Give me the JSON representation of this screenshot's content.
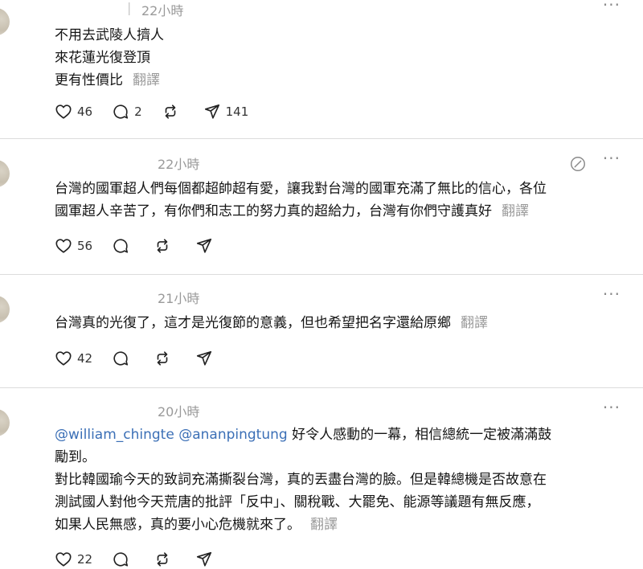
{
  "posts": [
    {
      "time": "22小時",
      "lines": [
        "不用去武陵人擠人",
        "來花蓮光復登頂",
        "更有性價比"
      ],
      "translate": "翻譯",
      "likes": "46",
      "comments": "2",
      "reposts": "",
      "shares": "141"
    },
    {
      "time": "22小時",
      "lines": [
        "台灣的國軍超人們每個都超帥超有愛，讓我對台灣的國軍充滿了無比的信心，各位",
        "國軍超人辛苦了，有你們和志工的努力真的超給力，台灣有你們守護真好"
      ],
      "translate": "翻譯",
      "likes": "56",
      "comments": "",
      "reposts": "",
      "shares": ""
    },
    {
      "time": "21小時",
      "lines": [
        "台灣真的光復了，這才是光復節的意義，但也希望把名字還給原鄉"
      ],
      "translate": "翻譯",
      "likes": "42",
      "comments": "",
      "reposts": "",
      "shares": ""
    },
    {
      "time": "20小時",
      "mention1": "@william_chingte",
      "mention2": "@ananpingtung",
      "line1_rest": " 好令人感動的一幕，相信總統一定被滿滿鼓",
      "lines": [
        "勵到。",
        "對比韓國瑜今天的致詞充滿撕裂台灣，真的丟盡台灣的臉。但是韓總機是否故意在",
        "測試國人對他今天荒唐的批評「反中」、關稅戰、大罷免、能源等議題有無反應，",
        "如果人民無感，真的要小心危機就來了。"
      ],
      "translate": "翻譯",
      "likes": "22",
      "comments": "",
      "reposts": "",
      "shares": ""
    }
  ],
  "more_label": "···",
  "icons": {
    "like": "heart-icon",
    "comment": "comment-bubble-icon",
    "repost": "repost-icon",
    "share": "send-icon",
    "edit": "edit-circle-icon"
  }
}
